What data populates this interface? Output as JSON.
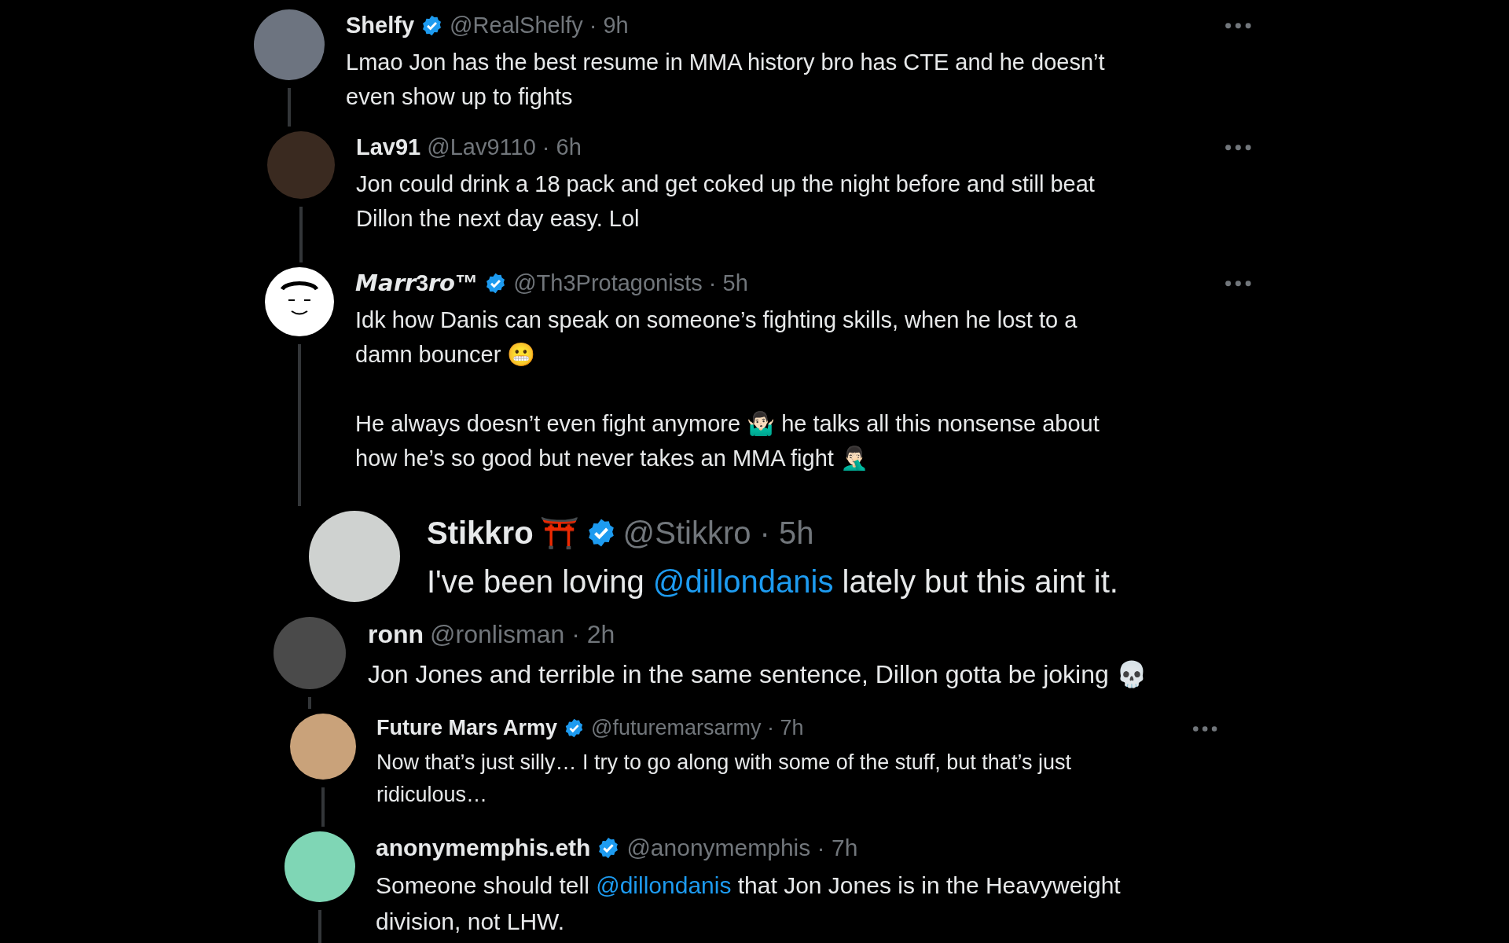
{
  "replies": [
    {
      "name": "Shelfy",
      "verified": true,
      "meta": "@RealShelfy · 9h",
      "more_menu": true,
      "thread_line": true,
      "avatar": {
        "kind": "photo"
      },
      "text": [
        {
          "kind": "plain",
          "text": "Lmao Jon has the best resume in MMA history bro has CTE and he doesn’t"
        },
        {
          "kind": "break"
        },
        {
          "kind": "plain",
          "text": "even show up to fights"
        }
      ]
    },
    {
      "name": "Lav91",
      "verified": false,
      "meta": "@Lav9110 · 6h",
      "more_menu": true,
      "thread_line": true,
      "avatar": {
        "kind": "photo"
      },
      "text": [
        {
          "kind": "plain",
          "text": "Jon could drink a 18 pack and get coked up the night before and still beat"
        },
        {
          "kind": "break"
        },
        {
          "kind": "plain",
          "text": "Dillon the next day easy. Lol"
        }
      ]
    },
    {
      "name": "𝙈𝙖𝙧𝙧3𝙧𝙤™",
      "verified": true,
      "meta": "@Th3Protagonists · 5h",
      "more_menu": true,
      "thread_line": true,
      "avatar": {
        "kind": "drawing"
      },
      "text": [
        {
          "kind": "plain",
          "text": "Idk how Danis can speak on someone’s fighting skills, when he lost to a"
        },
        {
          "kind": "break"
        },
        {
          "kind": "plain",
          "text": "damn bouncer 😬"
        },
        {
          "kind": "break"
        },
        {
          "kind": "break"
        },
        {
          "kind": "plain",
          "text": "He always doesn’t even fight anymore 🤷🏻‍♂️ he talks all this nonsense about"
        },
        {
          "kind": "break"
        },
        {
          "kind": "plain",
          "text": "how he’s so good but never takes an MMA fight 🤦🏻‍♂️"
        }
      ]
    },
    {
      "name": "Stikkro",
      "verified": true,
      "badge_emoji": "⛩️",
      "meta": "@Stikkro · 5h",
      "more_menu": false,
      "thread_line": false,
      "avatar": {
        "kind": "photo"
      },
      "text": [
        {
          "kind": "plain",
          "text": "I've been loving "
        },
        {
          "kind": "mention",
          "text": "@dillondanis"
        },
        {
          "kind": "plain",
          "text": " lately but this aint it."
        }
      ]
    },
    {
      "name": "ronn",
      "verified": false,
      "meta": "@ronlisman · 2h",
      "more_menu": false,
      "thread_line": true,
      "avatar": {
        "kind": "photo"
      },
      "text": [
        {
          "kind": "plain",
          "text": "Jon Jones and terrible in the same sentence, Dillon gotta be joking 💀"
        }
      ]
    },
    {
      "name": "Future Mars Army",
      "verified": true,
      "meta": "@futuremarsarmy · 7h",
      "more_menu": true,
      "thread_line": true,
      "avatar": {
        "kind": "photo"
      },
      "text": [
        {
          "kind": "plain",
          "text": "Now that’s just silly… I try to go along with some of the stuff, but that’s just"
        },
        {
          "kind": "break"
        },
        {
          "kind": "plain",
          "text": "ridiculous…"
        }
      ]
    },
    {
      "name": "anonymemphis.eth",
      "verified": true,
      "meta": "@anonymemphis · 7h",
      "more_menu": false,
      "thread_line": true,
      "avatar": {
        "kind": "photo"
      },
      "text": [
        {
          "kind": "plain",
          "text": "Someone should tell "
        },
        {
          "kind": "mention",
          "text": "@dillondanis"
        },
        {
          "kind": "plain",
          "text": " that Jon Jones is in the Heavyweight"
        },
        {
          "kind": "break"
        },
        {
          "kind": "plain",
          "text": "division, not LHW."
        }
      ]
    }
  ]
}
